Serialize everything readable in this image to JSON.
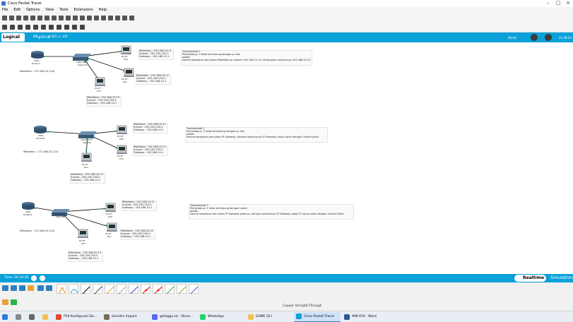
{
  "app": {
    "title": "Cisco Packet Tracer",
    "colors": {
      "accent": "#0aa0d8",
      "workspace": "#ffffff",
      "taskbar": "#e9eef5"
    }
  },
  "menu": [
    "File",
    "Edit",
    "Options",
    "View",
    "Tools",
    "Extensions",
    "Help"
  ],
  "view_tabs": {
    "logical": "Logical",
    "physical": "Physical",
    "coords": "x: 802, y: 100",
    "root": "[Root]",
    "clock": "21:49:20"
  },
  "bottom": {
    "time": "Time: 26:18:28",
    "realtime": "Realtime",
    "simulation": "Simulation",
    "connection_label": "Copper Straight-Through"
  },
  "topologies": [
    {
      "router": {
        "model": "2901",
        "name": "Router7",
        "ip": "IPAddress : 172.168.10.1/24"
      },
      "switch": {
        "model": "2960-24TT",
        "name": "Switch10"
      },
      "pcs": [
        {
          "model": "PC-PT",
          "name": "PC6",
          "info": [
            "IPAddress : 192.168.10.11",
            "Subnet : 255.255.255.0",
            "Gateway : 192.168.10.1"
          ]
        },
        {
          "model": "PC-PT",
          "name": "PC1",
          "info": [
            "IPAddress : 192.168.10.12",
            "Subnet : 255.255.255.0",
            "Gateway : 192.168.10.1"
          ]
        },
        {
          "model": "PC-PT",
          "name": "PC2",
          "info": [
            "IPAddress : 192.168.10.13",
            "Subnet : 255.255.255.0",
            "Gateway : 192.168.10.1"
          ]
        }
      ],
      "note": [
        "Troubleshoot 1",
        "Penyebab pc 3 tidak terhubung dengan pc lain",
        "jawab:",
        "karena kesalahan penulisan IPaddress pc seperti 192.168.11.13, diharuskan seharusnya 192.168.10.13"
      ]
    },
    {
      "router": {
        "model": "2901",
        "name": "Router8",
        "ip": "IPAddress : 172.168.10.1/24"
      },
      "switch": {
        "model": "2960-24TT",
        "name": "Switch2"
      },
      "pcs": [
        {
          "model": "PC-PT",
          "name": "PC8",
          "info": [
            "IPAddress : 192.168.10.11",
            "Subnet : 255.255.255.0",
            "Gateway : 192.168.10.1"
          ]
        },
        {
          "model": "PC-PT",
          "name": "PC4",
          "info": [
            "IPAddress : 192.168.10.12",
            "Subnet : 255.255.255.0",
            "Gateway : 192.168.10.1"
          ]
        },
        {
          "model": "PC-PT",
          "name": "PC3",
          "info": [
            "IPAddress : 192.168.10.13",
            "Subnet : 255.255.255.0",
            "Gateway : 192.168.10.1"
          ]
        }
      ],
      "note": [
        "Troubleshoot 2",
        "Penyebab pc 2 tidak terhubung dengan pc lain",
        "jawab:",
        "karena kesalahan penulisan IP Gateway, dimana seharusnya IP Gateway harus sama dengan Central point"
      ]
    },
    {
      "router": {
        "model": "2901",
        "name": "Router9",
        "ip": "IPAddress : 172.168.10.1/24"
      },
      "switch": {
        "model": "2960-24TT",
        "name": "Switch11"
      },
      "pcs": [
        {
          "model": "PC-PT",
          "name": "PC6",
          "info": [
            "IPAddress : 192.168.10.11",
            "Subnet : 255.255.255.0",
            "Gateway : 192.168.10.1"
          ]
        },
        {
          "model": "PC-PT",
          "name": "PC7",
          "info": [
            "IPAddress : 192.168.10.12",
            "Subnet : 255.255.255.0",
            "Gateway : 192.168.10.1"
          ]
        },
        {
          "model": "PC-PT",
          "name": "PC5",
          "info": [
            "IPAddress : 192.168.10.13",
            "Subnet : 255.255.255.0",
            "Gateway : 192.168.10.1"
          ]
        }
      ],
      "note": [
        "Troubleshoot 3",
        "Penyebab pc 1 tidak terhubung dengan router",
        "jawab:",
        "karena kesalahan penulisan IP Gateway pada pc, dimana seharusnya IP Gateway pada PC harus sama dengan Central Point"
      ]
    }
  ],
  "taskbar": [
    {
      "label": "P10 Konfigurasi Da...",
      "color": "#e2492f"
    },
    {
      "label": "Genshin Impact",
      "color": "#7a6a5a"
    },
    {
      "label": "@Angga.sis - Disco...",
      "color": "#5865f2"
    },
    {
      "label": "WhatsApp",
      "color": "#25d366"
    },
    {
      "label": "GAME (D:)",
      "color": "#f2c14e"
    },
    {
      "label": "Cisco Packet Tracer",
      "color": "#0aa0d8"
    },
    {
      "label": "996-P10 - Word",
      "color": "#2b579a"
    }
  ]
}
